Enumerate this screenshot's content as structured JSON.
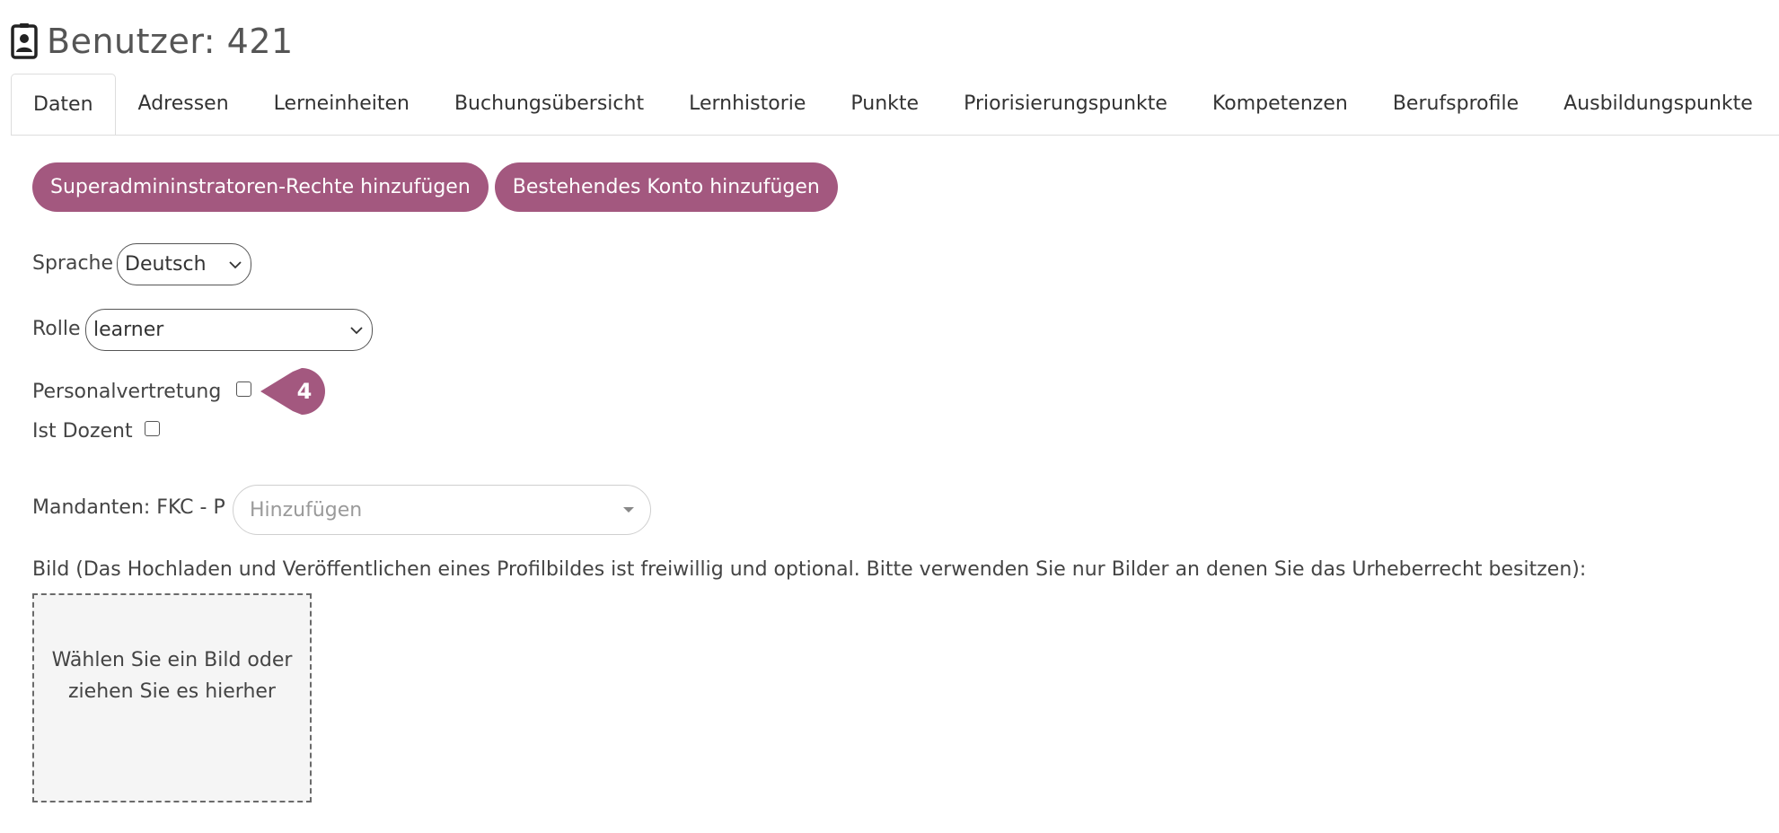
{
  "header": {
    "icon": "contact-card-icon",
    "title": "Benutzer: 421"
  },
  "tabs": [
    {
      "label": "Daten",
      "active": true
    },
    {
      "label": "Adressen"
    },
    {
      "label": "Lerneinheiten"
    },
    {
      "label": "Buchungsübersicht"
    },
    {
      "label": "Lernhistorie"
    },
    {
      "label": "Punkte"
    },
    {
      "label": "Priorisierungspunkte"
    },
    {
      "label": "Kompetenzen"
    },
    {
      "label": "Berufsprofile"
    },
    {
      "label": "Ausbildungspunkte"
    }
  ],
  "actions": {
    "superadmin_label": "Superadmininstratoren-Rechte hinzufügen",
    "existing_account_label": "Bestehendes Konto hinzufügen"
  },
  "form": {
    "language_label": "Sprache",
    "language_value": "Deutsch",
    "role_label": "Rolle",
    "role_value": "learner",
    "staff_rep_label": "Personalvertretung",
    "staff_rep_checked": false,
    "lecturer_label": "Ist Dozent",
    "lecturer_checked": false,
    "clients_label": "Mandanten: FKC - P",
    "clients_placeholder": "Hinzufügen",
    "image_label": "Bild (Das Hochladen und Veröffentlichen eines Profilbildes ist freiwillig und optional. Bitte verwenden Sie nur Bilder an denen Sie das Urheberrecht besitzen):",
    "dropzone_text": "Wählen Sie ein Bild oder ziehen Sie es hierher"
  },
  "tour_badge": {
    "number": "4"
  },
  "colors": {
    "accent": "#a3587f",
    "tab_border": "#dddddd",
    "dropzone_bg": "#f5f5f5"
  }
}
